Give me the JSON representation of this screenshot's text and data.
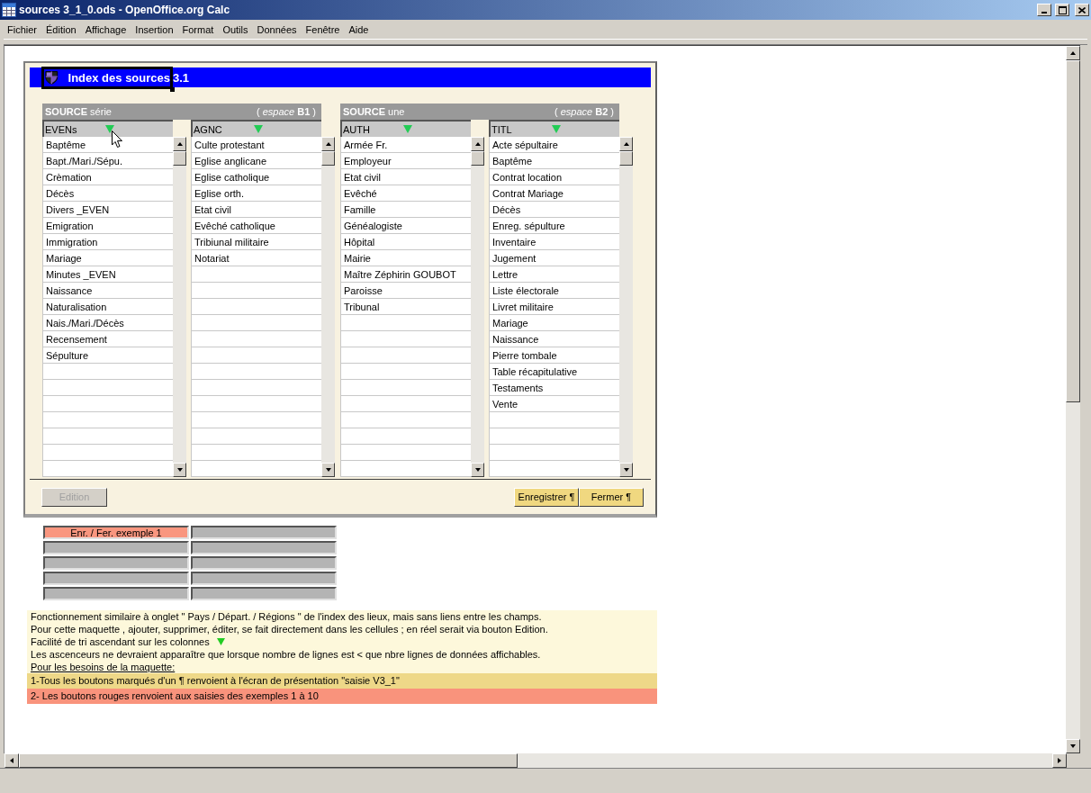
{
  "window": {
    "title": "sources 3_1_0.ods - OpenOffice.org Calc"
  },
  "menu": [
    "Fichier",
    "Édition",
    "Affichage",
    "Insertion",
    "Format",
    "Outils",
    "Données",
    "Fenêtre",
    "Aide"
  ],
  "dialog": {
    "title": "Index des sources",
    "version": "3.1",
    "groups": [
      {
        "title": "**SOURCE** série",
        "space": "( *espace* **B1** )",
        "columns": [
          {
            "header": "EVENs",
            "rows": [
              "Baptême",
              "Bapt./Mari./Sépu.",
              "Crèmation",
              "Décès",
              "Divers _EVEN",
              "Emigration",
              "Immigration",
              "Mariage",
              "Minutes _EVEN",
              "Naissance",
              "Naturalisation",
              "Nais./Mari./Décès",
              "Recensement",
              "Sépulture"
            ]
          },
          {
            "header": "AGNC",
            "rows": [
              "Culte protestant",
              "Eglise anglicane",
              "Eglise catholique",
              "Eglise orth.",
              "Etat civil",
              "Evêché catholique",
              "Tribiunal militaire",
              "Notariat"
            ]
          }
        ]
      },
      {
        "title": "**SOURCE** une",
        "space": "( *espace* **B2** )",
        "columns": [
          {
            "header": "AUTH",
            "rows": [
              "Armée Fr.",
              "Employeur",
              "Etat civil",
              "Evêché",
              "Famille",
              "Généalogiste",
              "Hôpital",
              "Mairie",
              "Maître Zéphirin GOUBOT",
              "Paroisse",
              "Tribunal"
            ]
          },
          {
            "header": "TITL",
            "rows": [
              "Acte sépultaire",
              "Baptême",
              "Contrat location",
              "Contrat Mariage",
              "Décès",
              "Enreg. sépulture",
              "Inventaire",
              "Jugement",
              "Lettre",
              "Liste électorale",
              "Livret militaire",
              "Mariage",
              "Naissance",
              "Pierre tombale",
              "Table récapitulative",
              "Testaments",
              "Vente"
            ]
          }
        ]
      }
    ],
    "buttons": [
      {
        "label": "Edition",
        "kind": "plain",
        "disabled": true
      },
      {
        "label": "Enregistrer ¶",
        "kind": "yellow",
        "disabled": false
      },
      {
        "label": "Fermer ¶",
        "kind": "yellow",
        "disabled": false
      }
    ]
  },
  "example_grid": [
    [
      {
        "text": "Enr. / Fer. exemple 1",
        "color": "#f9967f"
      },
      {
        "color": "#b4b4b4"
      }
    ],
    [
      {
        "color": "#b4b4b4"
      },
      {
        "color": "#b4b4b4"
      }
    ],
    [
      {
        "color": "#b4b4b4"
      },
      {
        "color": "#b4b4b4"
      }
    ],
    [
      {
        "color": "#b4b4b4"
      },
      {
        "color": "#b4b4b4"
      }
    ],
    [
      {
        "color": "#b4b4b4"
      },
      {
        "color": "#b4b4b4"
      }
    ]
  ],
  "notes": [
    {
      "text": "Fonctionnement similaire à onglet \" Pays / Départ. / Régions \" de l'index des lieux, mais sans liens entre les champs.",
      "color": "#fdf8db"
    },
    {
      "text": "Pour cette maquette , ajouter, supprimer, éditer, se fait directement dans les cellules ; en réel serait via bouton Edition.",
      "color": "#fdf8db"
    },
    {
      "text": "Facilité de tri ascendant sur les colonnes",
      "color": "#fdf8db",
      "sort_icon": true
    },
    {
      "text": "Les ascenceurs ne devraient apparaître que lorsque nombre de lignes  est  < que nbre  lignes de données affichables.",
      "color": "#fdf8db"
    },
    {
      "text": "Pour les besoins de la maquette:",
      "color": "#fdf8db",
      "underline": true
    },
    {
      "text": "1-Tous les boutons marqués d'un ¶ renvoient à l'écran de présentation \"saisie V3_1\"",
      "color": "#eed888"
    },
    {
      "text": "2- Les boutons rouges renvoient aux saisies des exemples 1 à 10",
      "color": "#f9937c"
    }
  ]
}
